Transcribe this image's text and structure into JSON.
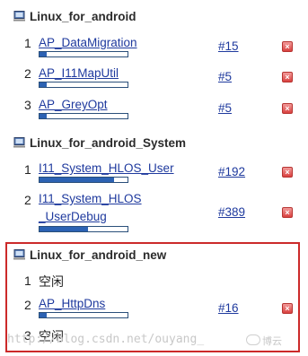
{
  "colors": {
    "link": "#1f3a9e",
    "progress_fill": "#2c62b3",
    "stop_red": "#d9413f",
    "highlight_border": "#cc2a2a"
  },
  "nodes": [
    {
      "icon": "computer-icon",
      "name": "Linux_for_android",
      "executors": [
        {
          "num": "1",
          "job": "AP_DataMigration",
          "build": "#15",
          "progress": 0.08
        },
        {
          "num": "2",
          "job": "AP_I11MapUtil",
          "build": "#5",
          "progress": 0.08
        },
        {
          "num": "3",
          "job": "AP_GreyOpt",
          "build": "#5",
          "progress": 0.08
        }
      ]
    },
    {
      "icon": "computer-icon",
      "name": "Linux_for_android_System",
      "executors": [
        {
          "num": "1",
          "job": "I11_System_HLOS_User",
          "build": "#192",
          "progress": 0.85
        },
        {
          "num": "2",
          "job_line1": "I11_System_HLOS",
          "job_line2": "_UserDebug",
          "build": "#389",
          "progress": 0.55
        }
      ]
    },
    {
      "icon": "computer-icon",
      "name": "Linux_for_android_new",
      "executors": [
        {
          "num": "1",
          "idle": "空闲"
        },
        {
          "num": "2",
          "job": "AP_HttpDns",
          "build": "#16",
          "progress": 0.08
        },
        {
          "num": "3",
          "idle": "空闲"
        }
      ]
    }
  ],
  "watermark": "http://blog.csdn.net/ouyang_",
  "brand_text": "博云"
}
